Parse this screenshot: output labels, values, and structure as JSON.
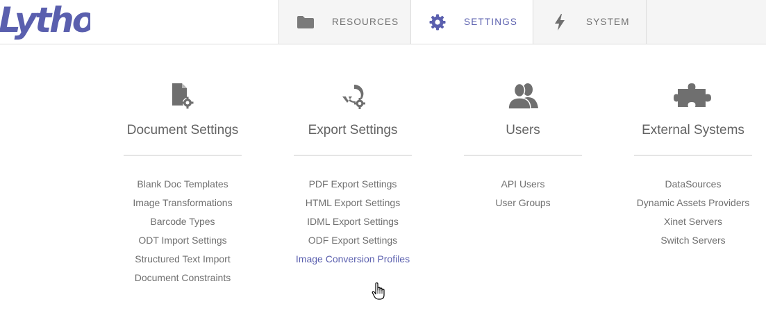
{
  "brand": {
    "logo_text": "Lytho",
    "accent": "#5a5fae"
  },
  "nav": {
    "tabs": [
      {
        "label": "RESOURCES",
        "icon": "folder-icon",
        "active": false
      },
      {
        "label": "SETTINGS",
        "icon": "gear-icon",
        "active": true
      },
      {
        "label": "SYSTEM",
        "icon": "lightning-icon",
        "active": false
      }
    ]
  },
  "sections": [
    {
      "title": "Document Settings",
      "icon": "document-settings-icon",
      "links": [
        "Blank Doc Templates",
        "Image Transformations",
        "Barcode Types",
        "ODT Import Settings",
        "Structured Text Import",
        "Document Constraints"
      ]
    },
    {
      "title": "Export Settings",
      "icon": "export-settings-icon",
      "links": [
        "PDF Export Settings",
        "HTML Export Settings",
        "IDML Export Settings",
        "ODF Export Settings",
        "Image Conversion Profiles"
      ],
      "hovered_link": "Image Conversion Profiles"
    },
    {
      "title": "Users",
      "icon": "users-icon",
      "links": [
        "API Users",
        "User Groups"
      ]
    },
    {
      "title": "External Systems",
      "icon": "puzzle-icon",
      "links": [
        "DataSources",
        "Dynamic Assets Providers",
        "Xinet Servers",
        "Switch Servers"
      ]
    }
  ]
}
